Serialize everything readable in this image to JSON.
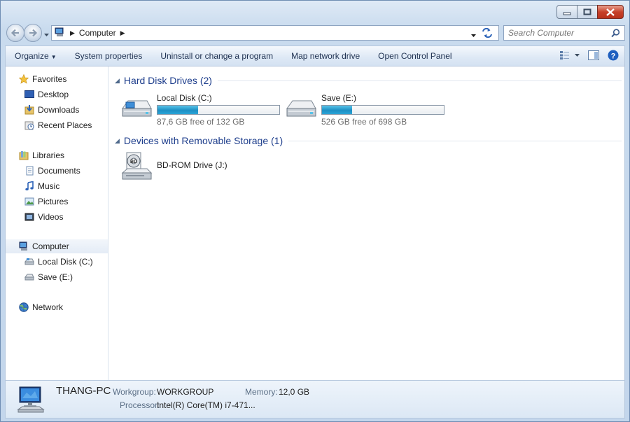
{
  "window": {
    "controls": {
      "minimize": "minimize",
      "maximize": "maximize",
      "close": "close"
    }
  },
  "address_bar": {
    "crumbs": [
      "Computer"
    ]
  },
  "search": {
    "placeholder": "Search Computer"
  },
  "toolbar": {
    "organize": "Organize",
    "system_properties": "System properties",
    "uninstall": "Uninstall or change a program",
    "map_drive": "Map network drive",
    "control_panel": "Open Control Panel"
  },
  "nav_pane": {
    "favorites": "Favorites",
    "desktop": "Desktop",
    "downloads": "Downloads",
    "recent_places": "Recent Places",
    "libraries": "Libraries",
    "documents": "Documents",
    "music": "Music",
    "pictures": "Pictures",
    "videos": "Videos",
    "computer": "Computer",
    "local_disk": "Local Disk (C:)",
    "save": "Save (E:)",
    "network": "Network"
  },
  "groups": {
    "hard_disks": {
      "header": "Hard Disk Drives (2)",
      "drives": [
        {
          "name": "Local Disk (C:)",
          "free_text": "87,6 GB free of 132 GB",
          "used_fraction": 0.336
        },
        {
          "name": "Save (E:)",
          "free_text": "526 GB free of 698 GB",
          "used_fraction": 0.246
        }
      ]
    },
    "removable": {
      "header": "Devices with Removable Storage (1)",
      "devices": [
        {
          "name": "BD-ROM Drive (J:)"
        }
      ]
    }
  },
  "details": {
    "pc_name": "THANG-PC",
    "workgroup_label": "Workgroup:",
    "workgroup_value": "WORKGROUP",
    "memory_label": "Memory:",
    "memory_value": "12,0 GB",
    "processor_label": "Processor:",
    "processor_value": "Intel(R) Core(TM) i7-471..."
  },
  "colors": {
    "accent": "#1e3e8c",
    "bar_fill": "#1d8fc4",
    "window_frame": "#c9dbee"
  }
}
